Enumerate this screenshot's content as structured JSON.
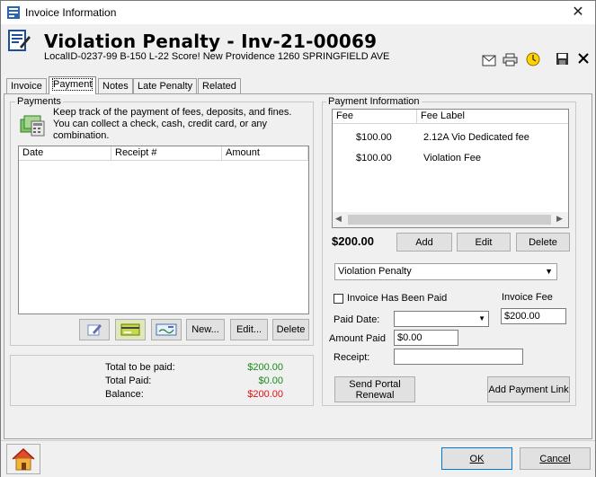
{
  "window": {
    "title": "Invoice Information",
    "close_glyph": "✕"
  },
  "header": {
    "title": "Violation Penalty - Inv-21-00069",
    "subtitle": "LocalID-0237-99  B-150   L-22   Score! New Providence    1260 SPRINGFIELD AVE"
  },
  "tabs": [
    {
      "label": "Invoice",
      "active": false
    },
    {
      "label": "Payment",
      "active": true
    },
    {
      "label": "Notes",
      "active": false
    },
    {
      "label": "Late Penalty",
      "active": false
    },
    {
      "label": "Related",
      "active": false
    }
  ],
  "payments": {
    "group_label": "Payments",
    "description": "Keep track of the payment of fees, deposits, and fines. You can collect a check, cash, credit card, or any combination.",
    "columns": [
      "Date",
      "Receipt #",
      "Amount"
    ],
    "rows": [],
    "buttons": {
      "new": "New...",
      "edit": "Edit...",
      "delete": "Delete"
    }
  },
  "totals": {
    "total_to_be_paid_label": "Total to be paid:",
    "total_to_be_paid": "$200.00",
    "total_paid_label": "Total Paid:",
    "total_paid": "$0.00",
    "balance_label": "Balance:",
    "balance": "$200.00",
    "colors": {
      "positive": "#1a8a1a",
      "negative": "#e01010"
    }
  },
  "payment_info": {
    "group_label": "Payment Information",
    "columns": [
      "Fee",
      "Fee Label"
    ],
    "fees": [
      {
        "fee": "$100.00",
        "label": "2.12A Vio Dedicated fee"
      },
      {
        "fee": "$100.00",
        "label": "Violation Fee"
      }
    ],
    "total": "$200.00",
    "buttons": {
      "add": "Add",
      "edit": "Edit",
      "delete": "Delete"
    },
    "type_select": "Violation Penalty",
    "invoice_paid_label": "Invoice Has Been Paid",
    "invoice_paid_checked": false,
    "invoice_fee_label": "Invoice Fee",
    "invoice_fee": "$200.00",
    "paid_date_label": "Paid Date:",
    "paid_date": "",
    "amount_paid_label": "Amount Paid",
    "amount_paid": "$0.00",
    "receipt_label": "Receipt:",
    "receipt": "",
    "send_portal_label": "Send Portal Renewal",
    "add_payment_link_label": "Add Payment Link"
  },
  "footer": {
    "ok": "OK",
    "cancel": "Cancel"
  },
  "icons": [
    "app-icon",
    "invoice-icon",
    "mail-icon",
    "print-icon",
    "clock-icon",
    "save-icon",
    "close-icon",
    "home-icon",
    "edit-payment-icon",
    "card-icon",
    "check-icon",
    "payments-icon"
  ]
}
